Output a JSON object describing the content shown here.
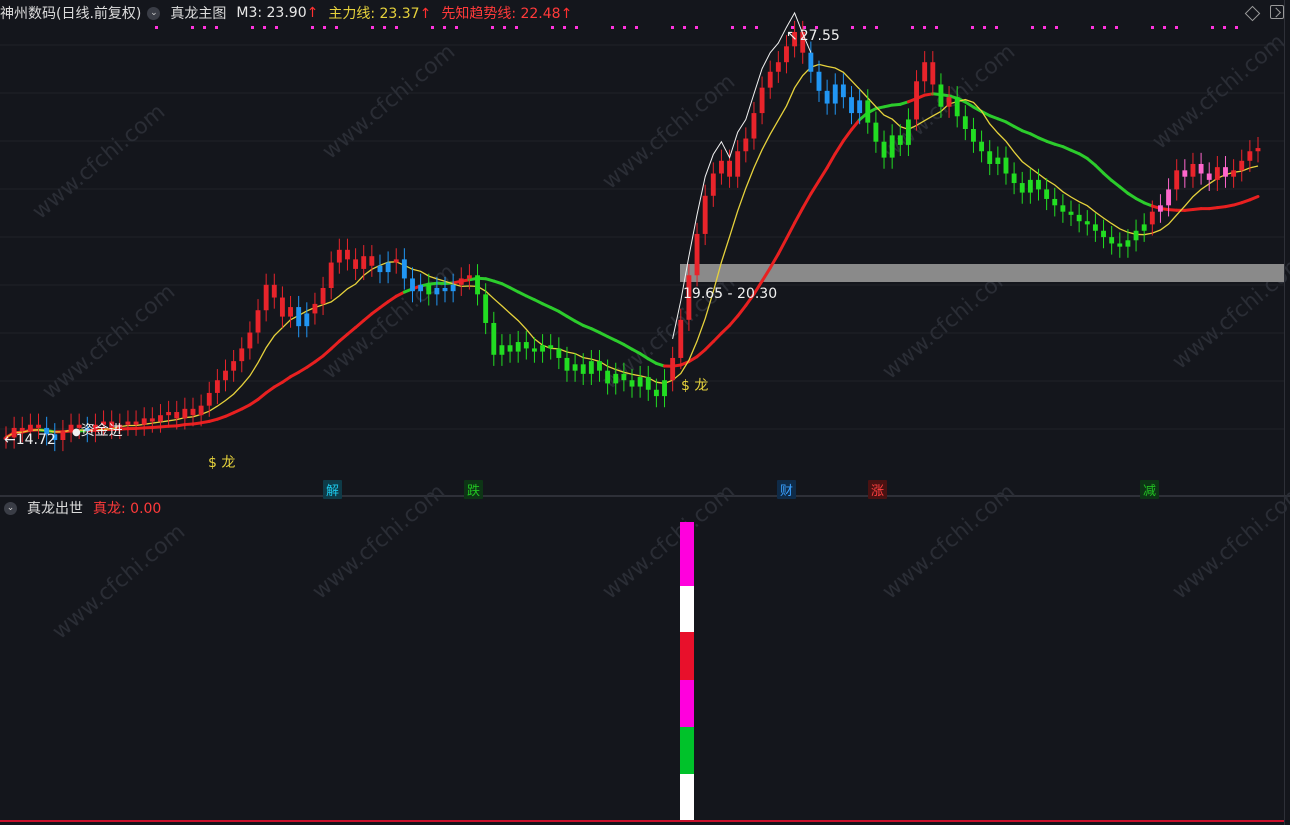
{
  "header_main": {
    "stock": "神州数码(日线.前复权)",
    "indicator": "真龙主图",
    "m3_label": "M3: 23.90",
    "main_line_label": "主力线: 23.37",
    "trend_label": "先知趋势线: 22.48",
    "arrow": "↑"
  },
  "header_sub": {
    "indicator": "真龙出世",
    "value_label": "真龙: 0.00"
  },
  "annotations": {
    "high_price": "27.55",
    "low_price": "←14.72",
    "zone_range": "19.65 - 20.30",
    "fund_in": "资金进",
    "dragon1": "$ 龙",
    "dragon2": "$ 龙"
  },
  "signals": [
    {
      "label": "解",
      "color": "#1cc6e8"
    },
    {
      "label": "跌",
      "color": "#22c222"
    },
    {
      "label": "财",
      "color": "#3aa0ff"
    },
    {
      "label": "涨",
      "color": "#e03030"
    },
    {
      "label": "减",
      "color": "#22c222"
    }
  ],
  "watermark": "www.cfchi.com",
  "colors": {
    "background": "#14161c",
    "up": "#e8242b",
    "down_blue": "#2196f3",
    "down_green": "#22dd22",
    "pink": "#ff66cc",
    "ma_yellow": "#e6d23c",
    "trend_red": "#e82020",
    "trend_green": "#2ccc2c",
    "zone": "#8a8a8a",
    "dot": "#ff33dd"
  },
  "chart_data": {
    "type": "candlestick",
    "price_axis_reference": {
      "high": 27.55,
      "low": 14.72
    },
    "highlight_zone": [
      19.65,
      20.3
    ],
    "close_series": [
      14.8,
      15.1,
      15.0,
      15.2,
      15.1,
      14.9,
      14.72,
      15.0,
      15.2,
      15.1,
      15.0,
      15.2,
      15.3,
      15.1,
      15.2,
      15.3,
      15.2,
      15.4,
      15.3,
      15.5,
      15.6,
      15.4,
      15.7,
      15.5,
      15.8,
      16.2,
      16.6,
      16.9,
      17.2,
      17.6,
      18.1,
      18.8,
      19.6,
      19.2,
      18.6,
      18.9,
      18.3,
      18.7,
      19.0,
      19.5,
      20.3,
      20.7,
      20.4,
      20.1,
      20.5,
      20.2,
      20.0,
      20.3,
      20.4,
      19.8,
      19.4,
      19.6,
      19.3,
      19.5,
      19.4,
      19.6,
      19.8,
      19.9,
      19.3,
      18.4,
      17.4,
      17.7,
      17.5,
      17.8,
      17.6,
      17.5,
      17.7,
      17.6,
      17.3,
      16.9,
      17.1,
      16.8,
      17.2,
      16.9,
      16.5,
      16.8,
      16.6,
      16.4,
      16.7,
      16.3,
      16.1,
      16.6,
      17.3,
      18.5,
      19.9,
      21.2,
      22.4,
      23.1,
      23.5,
      23.0,
      23.8,
      24.2,
      25.0,
      25.8,
      26.3,
      26.6,
      27.1,
      27.55,
      26.9,
      26.3,
      25.7,
      25.3,
      25.9,
      25.5,
      25.0,
      25.4,
      24.7,
      24.1,
      23.6,
      24.3,
      24.0,
      24.8,
      26.0,
      26.6,
      25.9,
      25.2,
      25.5,
      24.9,
      24.5,
      24.1,
      23.8,
      23.4,
      23.6,
      23.1,
      22.8,
      22.5,
      22.9,
      22.6,
      22.3,
      22.1,
      21.9,
      21.8,
      21.6,
      21.5,
      21.3,
      21.1,
      20.9,
      20.8,
      21.0,
      21.3,
      21.5,
      21.9,
      22.1,
      22.6,
      23.2,
      23.0,
      23.4,
      23.1,
      22.9,
      23.3,
      23.0,
      23.2,
      23.5,
      23.8,
      23.9
    ],
    "series": [
      {
        "name": "M3",
        "value": 23.9
      },
      {
        "name": "主力线",
        "value": 23.37
      },
      {
        "name": "先知趋势线",
        "value": 22.48
      }
    ],
    "sub_panel": {
      "name": "真龙",
      "value": 0.0
    }
  }
}
